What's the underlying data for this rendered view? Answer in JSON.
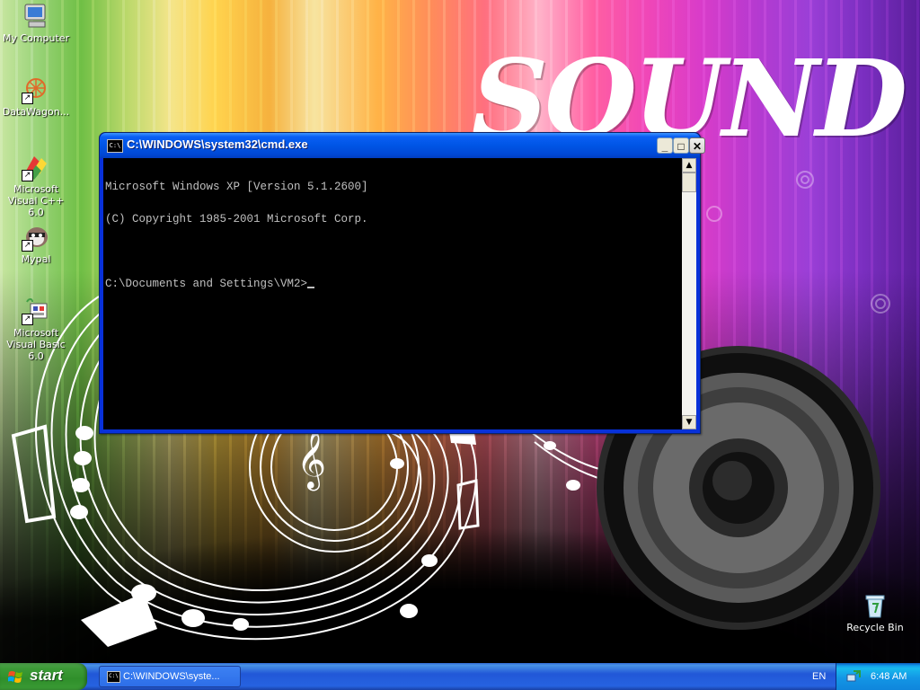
{
  "desktop": {
    "icons": [
      {
        "label": "My Computer",
        "icon": "my-computer-icon"
      },
      {
        "label": "DataWagon...",
        "icon": "datawagon-icon"
      },
      {
        "label": "Microsoft Visual C++ 6.0",
        "icon": "visual-cpp-icon"
      },
      {
        "label": "Mypal",
        "icon": "mypal-icon"
      },
      {
        "label": "Microsoft Visual Basic 6.0",
        "icon": "visual-basic-icon"
      },
      {
        "label": "Recycle Bin",
        "icon": "recycle-bin-icon"
      }
    ],
    "wallpaper_text": "SOUND"
  },
  "cmd_window": {
    "title": "C:\\WINDOWS\\system32\\cmd.exe",
    "icon_label": "C:\\",
    "minimize": "_",
    "maximize": "□",
    "close": "✕",
    "lines": [
      "Microsoft Windows XP [Version 5.1.2600]",
      "(C) Copyright 1985-2001 Microsoft Corp.",
      "",
      "C:\\Documents and Settings\\VM2>"
    ],
    "scroll_up": "▲",
    "scroll_down": "▼"
  },
  "taskbar": {
    "start_label": "start",
    "task_label": "C:\\WINDOWS\\syste...",
    "language": "EN",
    "clock": "6:48 AM"
  },
  "colors": {
    "taskbar_blue": "#2157d7",
    "start_green": "#3c9a37",
    "title_blue": "#0055e5",
    "console_text": "#c0c0c0"
  }
}
